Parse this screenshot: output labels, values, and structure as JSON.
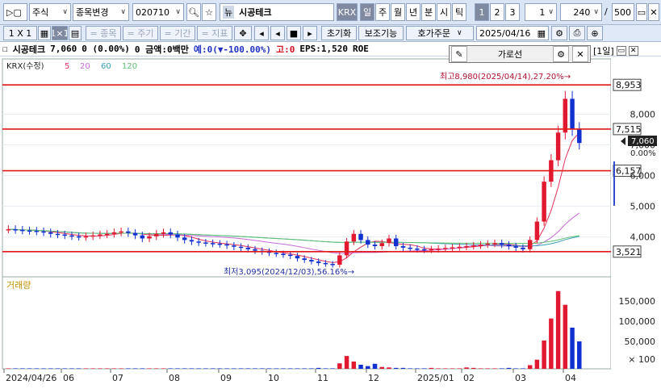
{
  "toolbar1": {
    "menu_btn": "▷▢",
    "asset_type": "주식",
    "symbol_change": "종목변경",
    "code": "020710",
    "name_prefix": "뉴",
    "name": "시공테크",
    "market_badge": "KRX",
    "periods": [
      "일",
      "주",
      "월",
      "년",
      "분",
      "시",
      "틱"
    ],
    "period_selected": "일",
    "counts": [
      "1",
      "2",
      "3"
    ],
    "count_selected": "1",
    "count_value": "1",
    "bars_value": "240",
    "bars_sep": "/",
    "bars_total": "500"
  },
  "toolbar2": {
    "layout": "1 X 1",
    "eq_item": "= 종목",
    "eq_period": "= 주기",
    "eq_range": "= 기간",
    "eq_indicator": "= 지표",
    "reset": "초기화",
    "aux": "보조기능",
    "quote_order": "호가주문",
    "date": "2025/04/16"
  },
  "infoline": {
    "name": "시공테크",
    "price": "7,060",
    "change": "0 (0.00%)",
    "amount": "0 금액:0백만",
    "expected": "예:0(▼-100.00%)",
    "high": "고:0",
    "eps": "EPS:1,520",
    "roe": "ROE"
  },
  "popup": {
    "label": "가로선"
  },
  "panel_period": "[1일]",
  "price_panel": {
    "legend": {
      "market": "KRX(수정)",
      "ma": [
        "5",
        "20",
        "60",
        "120"
      ],
      "ma_colors": [
        "#e8305a",
        "#c86ad8",
        "#3aa0b8",
        "#60c070"
      ]
    },
    "y_ticks": [
      "8,000",
      "7,000",
      "6,000",
      "5,000",
      "4,000"
    ],
    "hlines": [
      "8,953",
      "7,515",
      "6,157",
      "3,521"
    ],
    "current_price": "7,060",
    "current_pct": "0.00%",
    "max_note": "최고8,980(2025/04/14),27.20%→",
    "min_note": "최저3,095(2024/12/03),56.16%→"
  },
  "volume_panel": {
    "legend": "거래량",
    "y_ticks": [
      "150,000",
      "100,000",
      "50,000",
      "× 100"
    ]
  },
  "x_axis": [
    "2024/04/26",
    "06",
    "07",
    "08",
    "09",
    "10",
    "11",
    "12",
    "2025/01",
    "02",
    "03",
    "04"
  ],
  "chart_data": {
    "type": "candlestick",
    "price_range": [
      3095,
      8980
    ],
    "reference_lines": [
      8953,
      7515,
      6157,
      3521
    ],
    "last_close": 7060,
    "high": {
      "value": 8980,
      "date": "2025/04/14",
      "pct": 27.2
    },
    "low": {
      "value": 3095,
      "date": "2024/12/03",
      "pct": 56.16
    },
    "close_series": [
      4250,
      4230,
      4210,
      4200,
      4180,
      4150,
      4100,
      4080,
      4050,
      4020,
      4000,
      4020,
      4050,
      4080,
      4100,
      4150,
      4180,
      4130,
      4050,
      3950,
      4020,
      4100,
      4150,
      4080,
      3980,
      3900,
      3850,
      3820,
      3800,
      3780,
      3760,
      3720,
      3680,
      3650,
      3600,
      3550,
      3520,
      3480,
      3450,
      3420,
      3380,
      3300,
      3250,
      3200,
      3150,
      3120,
      3095,
      3400,
      3850,
      4100,
      3900,
      3750,
      3700,
      3800,
      3950,
      3700,
      3650,
      3620,
      3600,
      3580,
      3600,
      3620,
      3640,
      3660,
      3680,
      3700,
      3720,
      3750,
      3780,
      3800,
      3750,
      3700,
      3650,
      3600,
      3900,
      4500,
      5800,
      6500,
      7400,
      8500,
      7515,
      7060
    ],
    "volume_series": [
      1,
      1,
      1,
      1,
      1,
      1,
      1,
      1,
      1,
      1,
      1,
      1,
      1,
      1,
      1,
      1,
      1,
      1,
      1,
      1,
      1,
      1,
      1,
      1,
      1,
      1,
      1,
      1,
      1,
      1,
      1,
      1,
      1,
      1,
      1,
      1,
      1,
      1,
      1,
      1,
      1,
      1,
      1,
      1,
      2,
      1,
      1,
      12,
      28,
      16,
      9,
      6,
      11,
      4,
      3,
      2,
      2,
      1,
      1,
      1,
      2,
      1,
      1,
      1,
      1,
      3,
      2,
      1,
      1,
      1,
      1,
      2,
      1,
      1,
      8,
      20,
      62,
      110,
      170,
      140,
      90,
      60
    ]
  }
}
